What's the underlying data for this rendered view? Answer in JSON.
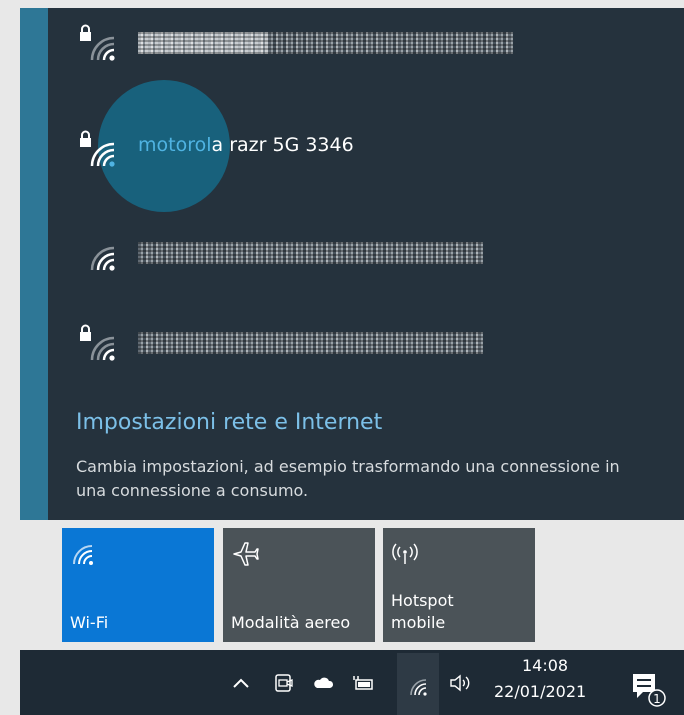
{
  "networks": [
    {
      "name": "",
      "secured": true,
      "obscured": true
    },
    {
      "name_highlight": "motorol",
      "name_rest": "a razr 5G 3346",
      "secured": true,
      "obscured": false
    },
    {
      "name": "",
      "secured": false,
      "obscured": true
    },
    {
      "name": "",
      "secured": true,
      "obscured": true
    }
  ],
  "settings": {
    "link": "Impostazioni rete e Internet",
    "description": "Cambia impostazioni, ad esempio trasformando una connessione in una connessione a consumo."
  },
  "quick_actions": [
    {
      "label": "Wi-Fi",
      "icon": "wifi-icon",
      "active": true
    },
    {
      "label": "Modalità aereo",
      "icon": "airplane-icon",
      "active": false
    },
    {
      "label": "Hotspot\nmobile",
      "icon": "hotspot-icon",
      "active": false
    }
  ],
  "taskbar": {
    "time": "14:08",
    "date": "22/01/2021",
    "notification_count": "1"
  },
  "colors": {
    "flyout_bg": "#25323d",
    "accent": "#0a77d5",
    "link": "#7cc0e8",
    "taskbar_bg": "#1e2a35"
  }
}
